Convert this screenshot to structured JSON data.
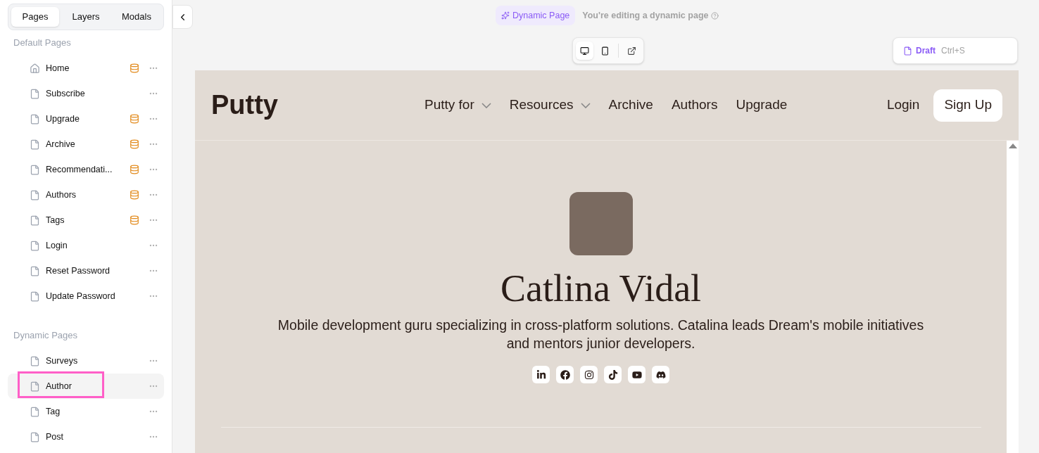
{
  "sidebar": {
    "tabs": [
      {
        "label": "Pages",
        "selected": true
      },
      {
        "label": "Layers",
        "selected": false
      },
      {
        "label": "Modals",
        "selected": false
      }
    ],
    "sections": [
      {
        "title": "Default Pages",
        "items": [
          {
            "label": "Home",
            "kind": "home",
            "database": true,
            "selected": false
          },
          {
            "label": "Subscribe",
            "kind": "page",
            "database": false,
            "selected": false
          },
          {
            "label": "Upgrade",
            "kind": "page",
            "database": true,
            "selected": false
          },
          {
            "label": "Archive",
            "kind": "page",
            "database": true,
            "selected": false
          },
          {
            "label": "Recommendati...",
            "kind": "page",
            "database": true,
            "selected": false
          },
          {
            "label": "Authors",
            "kind": "page",
            "database": true,
            "selected": false
          },
          {
            "label": "Tags",
            "kind": "page",
            "database": true,
            "selected": false
          },
          {
            "label": "Login",
            "kind": "page",
            "database": false,
            "selected": false
          },
          {
            "label": "Reset Password",
            "kind": "page",
            "database": false,
            "selected": false
          },
          {
            "label": "Update Password",
            "kind": "page",
            "database": false,
            "selected": false
          }
        ]
      },
      {
        "title": "Dynamic Pages",
        "items": [
          {
            "label": "Surveys",
            "kind": "page",
            "database": false,
            "selected": false
          },
          {
            "label": "Author",
            "kind": "page",
            "database": false,
            "selected": true
          },
          {
            "label": "Tag",
            "kind": "page",
            "database": false,
            "selected": false
          },
          {
            "label": "Post",
            "kind": "page",
            "database": false,
            "selected": false
          }
        ]
      }
    ]
  },
  "topbar": {
    "badge": "Dynamic Page",
    "notice": "You're editing a dynamic page",
    "devices": [
      {
        "kind": "desktop",
        "selected": true
      },
      {
        "kind": "mobile",
        "selected": false
      }
    ],
    "status": "Draft",
    "shortcut": "Ctrl+S"
  },
  "preview": {
    "logo": "Putty",
    "nav": [
      {
        "label": "Putty for",
        "dropdown": true
      },
      {
        "label": "Resources",
        "dropdown": true
      },
      {
        "label": "Archive",
        "dropdown": false
      },
      {
        "label": "Authors",
        "dropdown": false
      },
      {
        "label": "Upgrade",
        "dropdown": false
      }
    ],
    "login": "Login",
    "signup": "Sign Up",
    "author_name": "Catlina Vidal",
    "bio": "Mobile development guru specializing in cross-platform solutions. Catalina leads Dream's mobile initiatives and mentors junior developers.",
    "socials": [
      {
        "kind": "linkedin"
      },
      {
        "kind": "facebook"
      },
      {
        "kind": "instagram"
      },
      {
        "kind": "tiktok"
      },
      {
        "kind": "youtube"
      },
      {
        "kind": "discord"
      }
    ]
  }
}
